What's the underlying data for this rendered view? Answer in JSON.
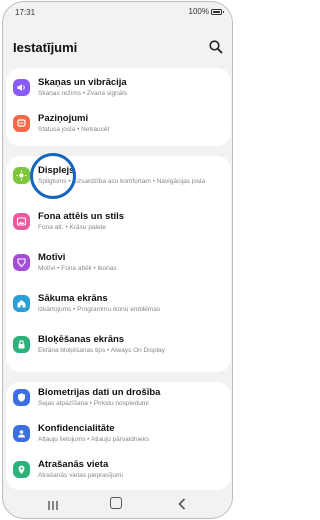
{
  "status": {
    "time": "17:31",
    "battery": "100%"
  },
  "header": {
    "title": "Iestatījumi"
  },
  "groups": [
    {
      "items": [
        {
          "title": "Skaņas un vibrācija",
          "subtitle": "Skaņas režīms  •  Zvana signāls",
          "icon": "volume-icon",
          "color": "#8a5cf6"
        },
        {
          "title": "Paziņojumi",
          "subtitle": "Statusa josla  •  Netraucēt",
          "icon": "bell-icon",
          "color": "#f06a4a"
        }
      ]
    },
    {
      "items": [
        {
          "title": "Displejs",
          "subtitle": "Spilgtums  •  Aizsardzība acu komfortam  •  Navigācijas josla",
          "icon": "sun-icon",
          "color": "#7cc73a"
        },
        {
          "title": "Fona attēls un stils",
          "subtitle": "Fona att.  •  Krāsu palete",
          "icon": "image-icon",
          "color": "#e85aa0"
        },
        {
          "title": "Motīvi",
          "subtitle": "Motīvi  •  Fona attēli  •  Ikonas",
          "icon": "themes-icon",
          "color": "#a24ed6"
        },
        {
          "title": "Sākuma ekrāns",
          "subtitle": "Izkārtojums  •  Programmu ikonu emblēmas",
          "icon": "home-icon",
          "color": "#2a9fd6"
        },
        {
          "title": "Bloķēšanas ekrāns",
          "subtitle": "Ekrāna bloķēšanas tips  •  Always On Display",
          "icon": "lock-icon",
          "color": "#2eb07a"
        }
      ]
    },
    {
      "items": [
        {
          "title": "Biometrijas dati un drošība",
          "subtitle": "Sejas atpazīšana  •  Pirkstu nospiedumi",
          "icon": "shield-icon",
          "color": "#3d6fe0"
        },
        {
          "title": "Konfidencialitāte",
          "subtitle": "Atļauju lietojums  •  Atļauju pārvaldnieks",
          "icon": "privacy-icon",
          "color": "#3d6fe0"
        },
        {
          "title": "Atrašanās vieta",
          "subtitle": "Atrašanās vietas pieprasījumi",
          "icon": "location-icon",
          "color": "#2eb07a"
        }
      ]
    }
  ]
}
